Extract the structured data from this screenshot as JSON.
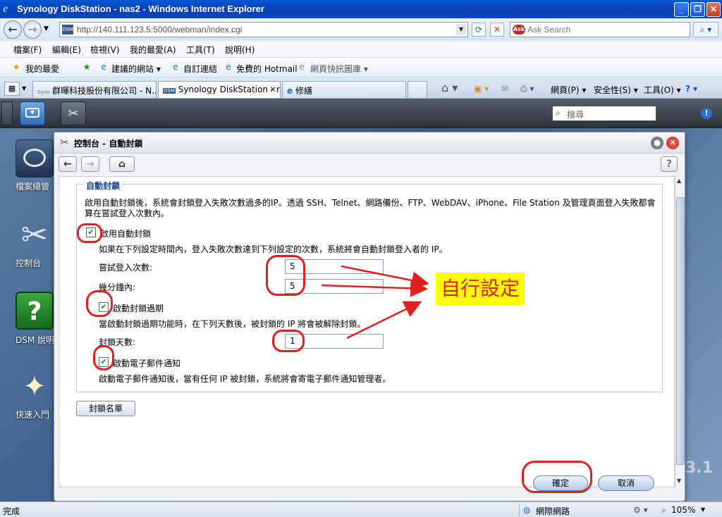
{
  "browser": {
    "title": "Synology DiskStation - nas2 - Windows Internet Explorer",
    "address": "http://140.111.123.5:5000/webman/index.cgi",
    "search_placeholder": "Ask Search",
    "menu": [
      "檔案(F)",
      "編輯(E)",
      "檢視(V)",
      "我的最愛(A)",
      "工具(T)",
      "說明(H)"
    ],
    "favorites": {
      "label": "我的最愛",
      "items": [
        "建議的網站 ▾",
        "自訂連結",
        "免費的 Hotmail",
        "網頁快訊圖庫 ▾"
      ]
    },
    "tabs": [
      "群暉科技股份有限公司 - N...",
      "Synology DiskStation - na...",
      "修繕"
    ],
    "tab_toolbar": [
      "網頁(P) ▾",
      "安全性(S) ▾",
      "工具(O) ▾"
    ],
    "favicon_text": "DSM",
    "synology_tab_favicon": "Syno"
  },
  "dsm": {
    "search_placeholder": "搜尋",
    "desktop_icons": [
      "檔案總管",
      "控制台",
      "DSM 說明",
      "快速入門"
    ],
    "version_hint": "3.1"
  },
  "window": {
    "title": "控制台 - 自動封鎖",
    "section_title": "自動封鎖",
    "description": "啟用自動封鎖後，系統會封鎖登入失敗次數過多的IP。透過 SSH、Telnet、網路備份、FTP、WebDAV、iPhone、File Station 及管理頁面登入失敗都會算在嘗試登入次數內。",
    "enable_label": "啟用自動封鎖",
    "enable_checked": true,
    "enable_desc": "如果在下列設定時間內，登入失敗次數達到下列設定的次數，系統將會自動封鎖登入者的 IP。",
    "attempts_label": "嘗試登入次數:",
    "attempts_value": "5",
    "minutes_label": "幾分鐘內:",
    "minutes_value": "5",
    "expire_label": "啟動封鎖過期",
    "expire_checked": true,
    "expire_desc": "當啟動封鎖過期功能時，在下列天數後，被封鎖的 IP 將會被解除封鎖。",
    "days_label": "封鎖天數:",
    "days_value": "1",
    "email_label": "啟動電子郵件通知",
    "email_checked": true,
    "email_desc": "啟動電子郵件通知後，當有任何 IP 被封鎖，系統將會寄電子郵件通知管理者。",
    "blocklist_button": "封鎖名單",
    "ok_button": "確定",
    "cancel_button": "取消"
  },
  "annotation": {
    "callout": "自行設定",
    "color": "#e0201c"
  },
  "status": {
    "left": "完成",
    "zone": "網際網路",
    "zoom": "105%"
  }
}
